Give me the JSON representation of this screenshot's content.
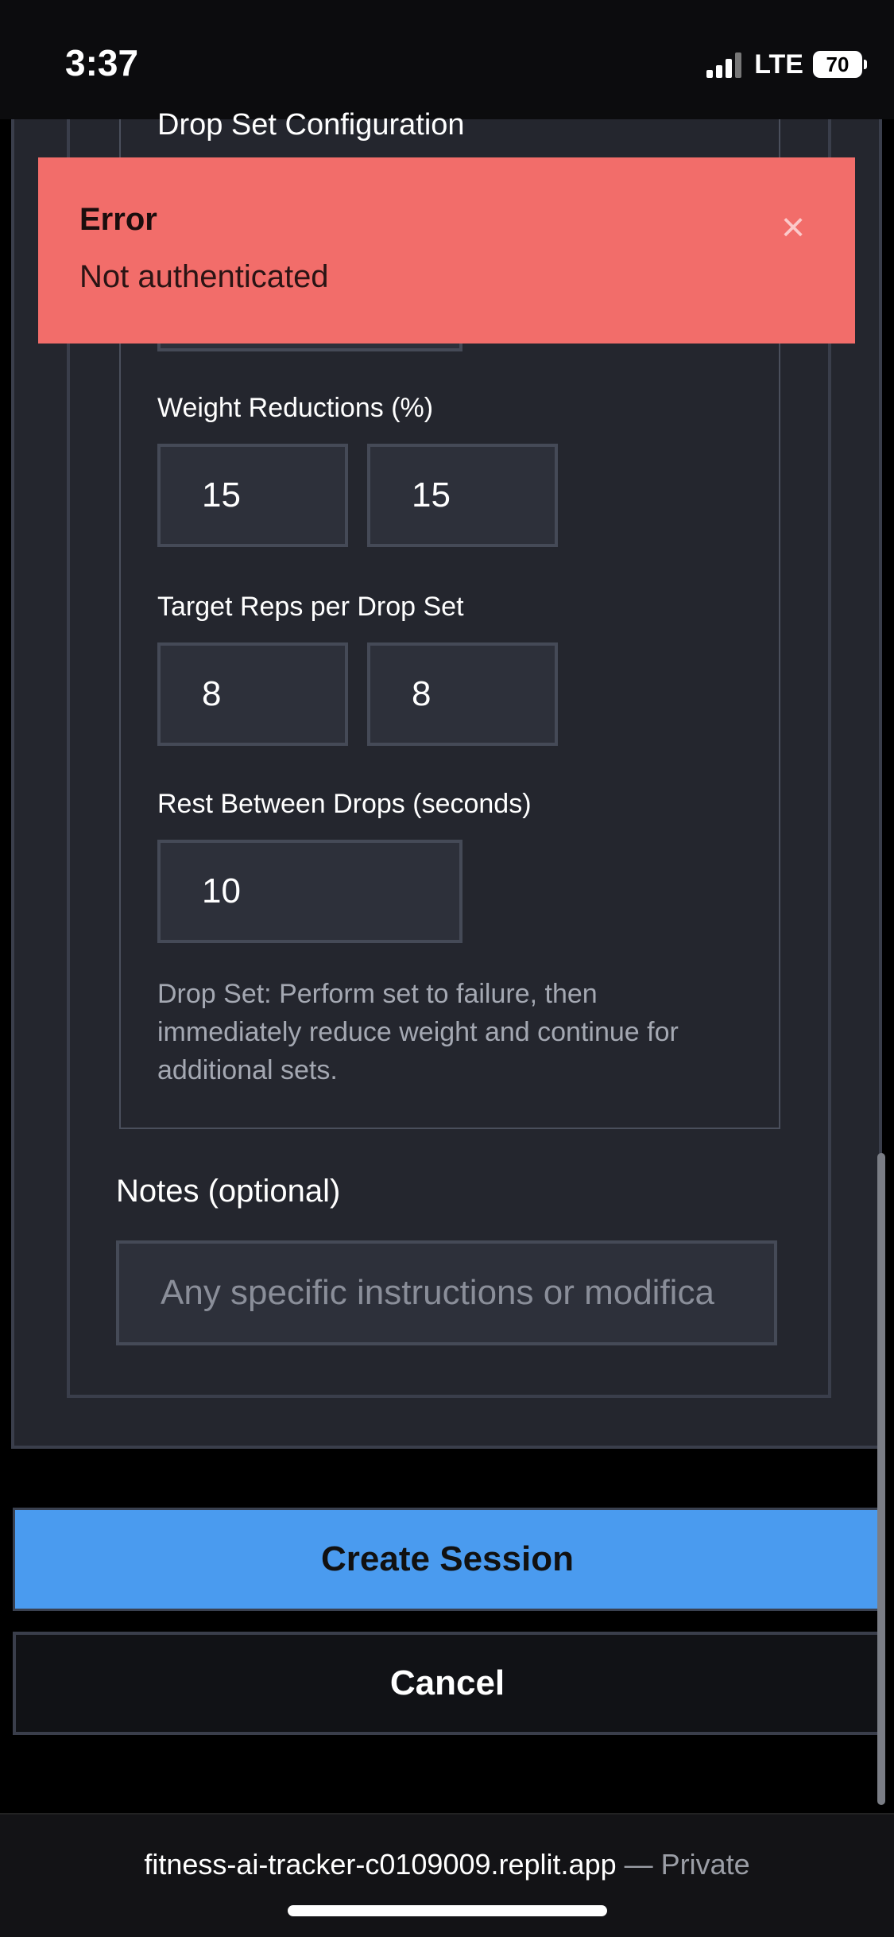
{
  "status_bar": {
    "time": "3:37",
    "network": "LTE",
    "battery": "70"
  },
  "form": {
    "section_title": "Drop Set Configuration",
    "weight_reductions_label": "Weight Reductions (%)",
    "weight_reductions": [
      "15",
      "15"
    ],
    "target_reps_label": "Target Reps per Drop Set",
    "target_reps": [
      "8",
      "8"
    ],
    "rest_label": "Rest Between Drops (seconds)",
    "rest_value": "10",
    "hint": "Drop Set: Perform set to failure, then immediately reduce weight and continue for additional sets.",
    "notes_label": "Notes (optional)",
    "notes_placeholder": "Any specific instructions or modifica"
  },
  "actions": {
    "create_label": "Create Session",
    "cancel_label": "Cancel"
  },
  "toast": {
    "title": "Error",
    "message": "Not authenticated",
    "close_glyph": "×"
  },
  "browser": {
    "url": "fitness-ai-tracker-c0109009.replit.app",
    "suffix": "— Private"
  },
  "colors": {
    "accent": "#4a9bef",
    "error": "#f26d6a",
    "background": "#24262e"
  }
}
